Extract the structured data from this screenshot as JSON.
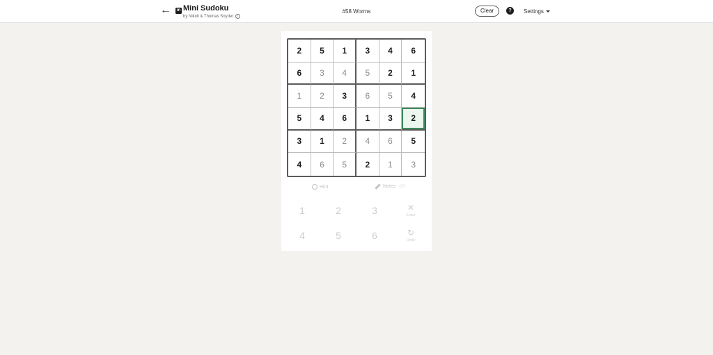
{
  "header": {
    "back_icon": "arrow-left-icon",
    "logo_text": "in",
    "app_title": "Mini Sudoku",
    "byline": "by Nikoli & Thomas Snyder",
    "info_glyph": "i",
    "puzzle_title": "#58 Worms",
    "clear_label": "Clear",
    "help_glyph": "?",
    "settings_label": "Settings"
  },
  "board": {
    "rows": [
      [
        {
          "v": "2",
          "given": true
        },
        {
          "v": "5",
          "given": true
        },
        {
          "v": "1",
          "given": true
        },
        {
          "v": "3",
          "given": true
        },
        {
          "v": "4",
          "given": true
        },
        {
          "v": "6",
          "given": true
        }
      ],
      [
        {
          "v": "6",
          "given": true
        },
        {
          "v": "3",
          "given": false
        },
        {
          "v": "4",
          "given": false
        },
        {
          "v": "5",
          "given": false
        },
        {
          "v": "2",
          "given": true
        },
        {
          "v": "1",
          "given": true
        }
      ],
      [
        {
          "v": "1",
          "given": false
        },
        {
          "v": "2",
          "given": false
        },
        {
          "v": "3",
          "given": true
        },
        {
          "v": "6",
          "given": false
        },
        {
          "v": "5",
          "given": false
        },
        {
          "v": "4",
          "given": true
        }
      ],
      [
        {
          "v": "5",
          "given": true
        },
        {
          "v": "4",
          "given": true
        },
        {
          "v": "6",
          "given": true
        },
        {
          "v": "1",
          "given": true
        },
        {
          "v": "3",
          "given": true
        },
        {
          "v": "2",
          "given": true,
          "selected": true
        }
      ],
      [
        {
          "v": "3",
          "given": true
        },
        {
          "v": "1",
          "given": true
        },
        {
          "v": "2",
          "given": false
        },
        {
          "v": "4",
          "given": false
        },
        {
          "v": "6",
          "given": false
        },
        {
          "v": "5",
          "given": true
        }
      ],
      [
        {
          "v": "4",
          "given": true
        },
        {
          "v": "6",
          "given": false
        },
        {
          "v": "5",
          "given": false
        },
        {
          "v": "2",
          "given": true
        },
        {
          "v": "1",
          "given": false
        },
        {
          "v": "3",
          "given": false
        }
      ]
    ],
    "colors": {
      "selected_border": "#3c8a5c",
      "selected_fill": "#eaf6ee"
    }
  },
  "tools": {
    "hint_label": "Hint",
    "notes_label": "Notes",
    "notes_state": "Off"
  },
  "keypad": {
    "keys": [
      "1",
      "2",
      "3",
      "4",
      "5",
      "6"
    ],
    "erase_label": "Erase",
    "undo_label": "Undo"
  }
}
